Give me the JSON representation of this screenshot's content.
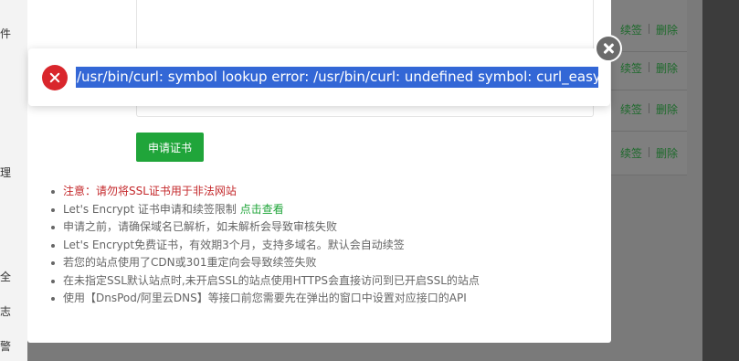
{
  "sidebar": {
    "items": [
      "件",
      "理",
      "全",
      "志",
      "警"
    ]
  },
  "table": {
    "rows": [
      {
        "renew": "续签",
        "delete": "删除"
      },
      {
        "renew": "续签",
        "delete": "删除"
      },
      {
        "renew": "续签",
        "delete": "删除"
      },
      {
        "renew": "续签",
        "delete": "删除"
      }
    ]
  },
  "modal": {
    "apply_button": "申请证书",
    "notes": [
      {
        "text": "注意：请勿将SSL证书用于非法网站"
      },
      {
        "text": "Let's Encrypt 证书申请和续签限制 ",
        "link": "点击查看"
      },
      {
        "text": "申请之前，请确保域名已解析，如未解析会导致审核失败"
      },
      {
        "text": "Let's Encrypt免费证书，有效期3个月，支持多域名。默认会自动续签"
      },
      {
        "text": "若您的站点使用了CDN或301重定向会导致续签失败"
      },
      {
        "text": "在未指定SSL默认站点时,未开启SSL的站点使用HTTPS会直接访问到已开启SSL的站点"
      },
      {
        "text": "使用【DnsPod/阿里云DNS】等接口前您需要先在弹出的窗口中设置对应接口的API"
      }
    ]
  },
  "toast": {
    "message": "/usr/bin/curl: symbol lookup error: /usr/bin/curl: undefined symbol: curl_easy_header",
    "icon": "error-icon",
    "close_icon": "close-icon"
  },
  "colors": {
    "accent": "#20a53a",
    "error": "#d9262c",
    "warning_text": "#c4282b",
    "selection": "#3367d6"
  }
}
